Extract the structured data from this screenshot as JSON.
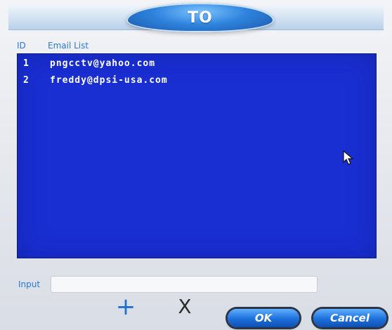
{
  "dialog": {
    "title": "TO"
  },
  "list": {
    "headers": {
      "id": "ID",
      "email": "Email List"
    },
    "rows": [
      {
        "id": "1",
        "email": "pngcctv@yahoo.com"
      },
      {
        "id": "2",
        "email": "freddy@dpsi-usa.com"
      }
    ]
  },
  "input": {
    "label": "Input",
    "value": ""
  },
  "actions": {
    "add_symbol": "+",
    "delete_symbol": "X",
    "ok_label": "OK",
    "cancel_label": "Cancel"
  },
  "colors": {
    "list_background": "#1a2fd2",
    "title_accent": "#2e83dd",
    "label_text": "#2b79d4",
    "button_accent": "#1d6fdb"
  },
  "icons": {
    "cursor": "mouse-pointer-icon",
    "add": "plus-icon",
    "delete": "close-icon"
  }
}
